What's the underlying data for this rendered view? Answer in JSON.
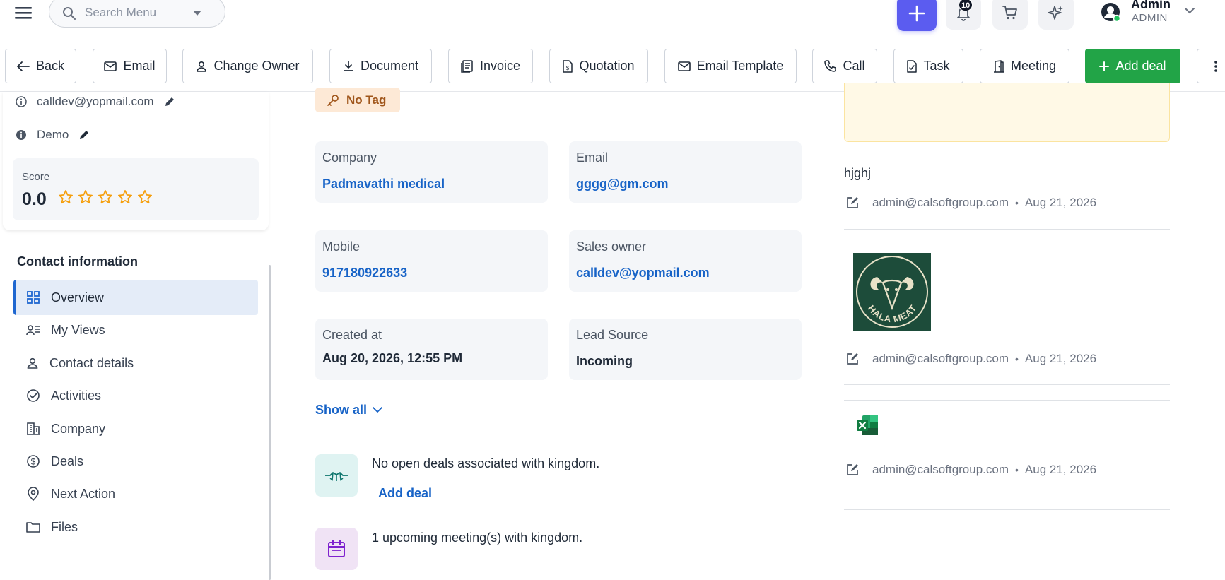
{
  "search": {
    "placeholder": "Search Menu"
  },
  "header": {
    "notification_count": "10",
    "user_name": "Admin",
    "user_role": "ADMIN"
  },
  "toolbar": {
    "back": "Back",
    "email": "Email",
    "change_owner": "Change Owner",
    "document": "Document",
    "invoice": "Invoice",
    "quotation": "Quotation",
    "email_template": "Email Template",
    "call": "Call",
    "task": "Task",
    "meeting": "Meeting",
    "add_deal": "Add deal"
  },
  "contact": {
    "email": "calldev@yopmail.com",
    "note": "Demo",
    "score_label": "Score",
    "score_value": "0.0",
    "stars_filled": 0,
    "stars_total": 5
  },
  "nav": {
    "title": "Contact information",
    "items": [
      {
        "label": "Overview",
        "icon": "grid-icon",
        "active": true
      },
      {
        "label": "My Views",
        "icon": "views-icon"
      },
      {
        "label": "Contact details",
        "icon": "person-icon"
      },
      {
        "label": "Activities",
        "icon": "check-circle-icon"
      },
      {
        "label": "Company",
        "icon": "building-icon"
      },
      {
        "label": "Deals",
        "icon": "dollar-icon"
      },
      {
        "label": "Next Action",
        "icon": "pin-icon"
      },
      {
        "label": "Files",
        "icon": "folder-icon"
      }
    ]
  },
  "main": {
    "tag": "No Tag",
    "fields": [
      {
        "label": "Company",
        "value": "Padmavathi medical",
        "link": true
      },
      {
        "label": "Email",
        "value": "gggg@gm.com",
        "link": true
      },
      {
        "label": "Mobile",
        "value": "917180922633",
        "link": true
      },
      {
        "label": "Sales owner",
        "value": "calldev@yopmail.com",
        "link": true
      },
      {
        "label": "Created at",
        "value": "Aug 20, 2026, 12:55 PM",
        "link": false
      },
      {
        "label": "Lead Source",
        "value": "Incoming",
        "link": false
      }
    ],
    "show_all": "Show all",
    "deals_text": "No open deals associated with kingdom.",
    "add_deal_link": "Add deal",
    "meetings_text": "1 upcoming meeting(s) with kingdom."
  },
  "notes": {
    "title": "hjghj",
    "entries": [
      {
        "author": "admin@calsoftgroup.com",
        "date": "Aug 21, 2026"
      },
      {
        "author": "admin@calsoftgroup.com",
        "date": "Aug 21, 2026"
      },
      {
        "author": "admin@calsoftgroup.com",
        "date": "Aug 21, 2026"
      }
    ],
    "logo_text": "HALA MEAT"
  },
  "colors": {
    "accent": "#5b5cf0",
    "primary_green": "#22a447",
    "link_blue": "#1763c7",
    "star_orange": "#f59e0b"
  }
}
